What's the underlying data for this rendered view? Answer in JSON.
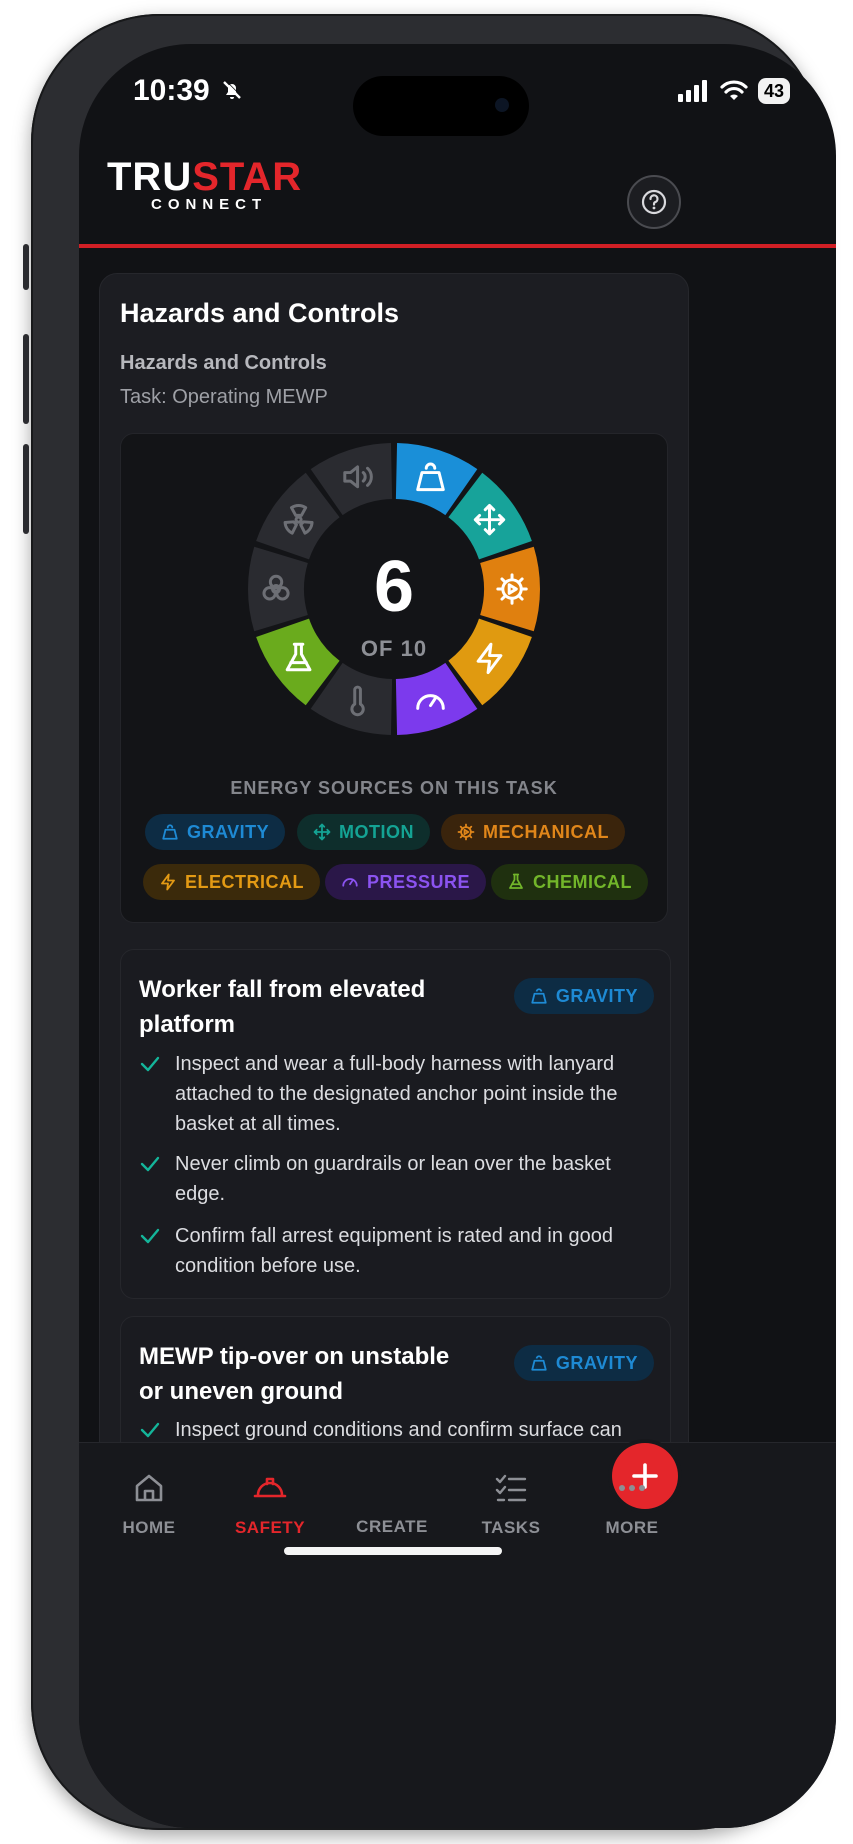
{
  "status_bar": {
    "time": "10:39",
    "battery": "43"
  },
  "header": {
    "logo_primary_white": "TRU",
    "logo_primary_red": "STAR",
    "logo_secondary": "CONNECT",
    "help_icon": "question-circle-icon"
  },
  "page": {
    "title": "Hazards and Controls",
    "section_title": "Hazards and Controls",
    "task_line": "Task: Operating MEWP"
  },
  "energy_wheel": {
    "count": "6",
    "count_of": "OF 10",
    "segments": [
      {
        "name": "gravity",
        "active": true,
        "color": "#1a8fd8",
        "icon": "weight-icon"
      },
      {
        "name": "motion",
        "active": true,
        "color": "#17a39a",
        "icon": "move-arrows-icon"
      },
      {
        "name": "mechanical",
        "active": true,
        "color": "#e0800f",
        "icon": "gear-icon"
      },
      {
        "name": "electrical",
        "active": true,
        "color": "#e09a10",
        "icon": "lightning-icon"
      },
      {
        "name": "pressure",
        "active": true,
        "color": "#7c3aed",
        "icon": "gauge-icon"
      },
      {
        "name": "temperature",
        "active": false,
        "color": "#2a2b30",
        "icon": "thermometer-icon"
      },
      {
        "name": "chemical",
        "active": true,
        "color": "#6aab1d",
        "icon": "flask-icon"
      },
      {
        "name": "biological",
        "active": false,
        "color": "#2a2b30",
        "icon": "biohazard-icon"
      },
      {
        "name": "radiation",
        "active": false,
        "color": "#2a2b30",
        "icon": "radiation-icon"
      },
      {
        "name": "sound",
        "active": false,
        "color": "#2a2b30",
        "icon": "speaker-icon"
      }
    ],
    "sources_label": "ENERGY SOURCES ON THIS TASK",
    "chips": [
      {
        "label": "GRAVITY",
        "color": "#1e8ad4",
        "bg": "#0d2c44",
        "icon": "weight-icon"
      },
      {
        "label": "MOTION",
        "color": "#14a394",
        "bg": "#0e2e2c",
        "icon": "move-arrows-icon"
      },
      {
        "label": "MECHANICAL",
        "color": "#e0861a",
        "bg": "#3a240c",
        "icon": "gear-icon"
      },
      {
        "label": "ELECTRICAL",
        "color": "#e39a14",
        "bg": "#3b2a0b",
        "icon": "lightning-icon"
      },
      {
        "label": "PRESSURE",
        "color": "#8b53f0",
        "bg": "#2a1748",
        "icon": "gauge-icon"
      },
      {
        "label": "CHEMICAL",
        "color": "#72b52a",
        "bg": "#1f300f",
        "icon": "flask-icon"
      }
    ]
  },
  "hazards": [
    {
      "title": "Worker fall from elevated platform",
      "badge": "GRAVITY",
      "controls": [
        "Inspect and wear a full-body harness with lanyard attached to the designated anchor point inside the basket at all times.",
        "Never climb on guardrails or lean over the basket edge.",
        "Confirm fall arrest equipment is rated and in good condition before use."
      ]
    },
    {
      "title": "MEWP tip-over on unstable or uneven ground",
      "badge": "GRAVITY",
      "controls": [
        "Inspect ground conditions and confirm surface can support the MEWP's rated load before"
      ]
    }
  ],
  "tabbar": {
    "items": [
      {
        "label": "HOME",
        "icon": "home-icon",
        "active": false
      },
      {
        "label": "SAFETY",
        "icon": "hard-hat-icon",
        "active": true
      },
      {
        "label": "CREATE",
        "icon": "plus-icon",
        "active": false
      },
      {
        "label": "TASKS",
        "icon": "checklist-icon",
        "active": false
      },
      {
        "label": "MORE",
        "icon": "more-dots-icon",
        "active": false
      }
    ],
    "active_color": "#e4262b"
  }
}
